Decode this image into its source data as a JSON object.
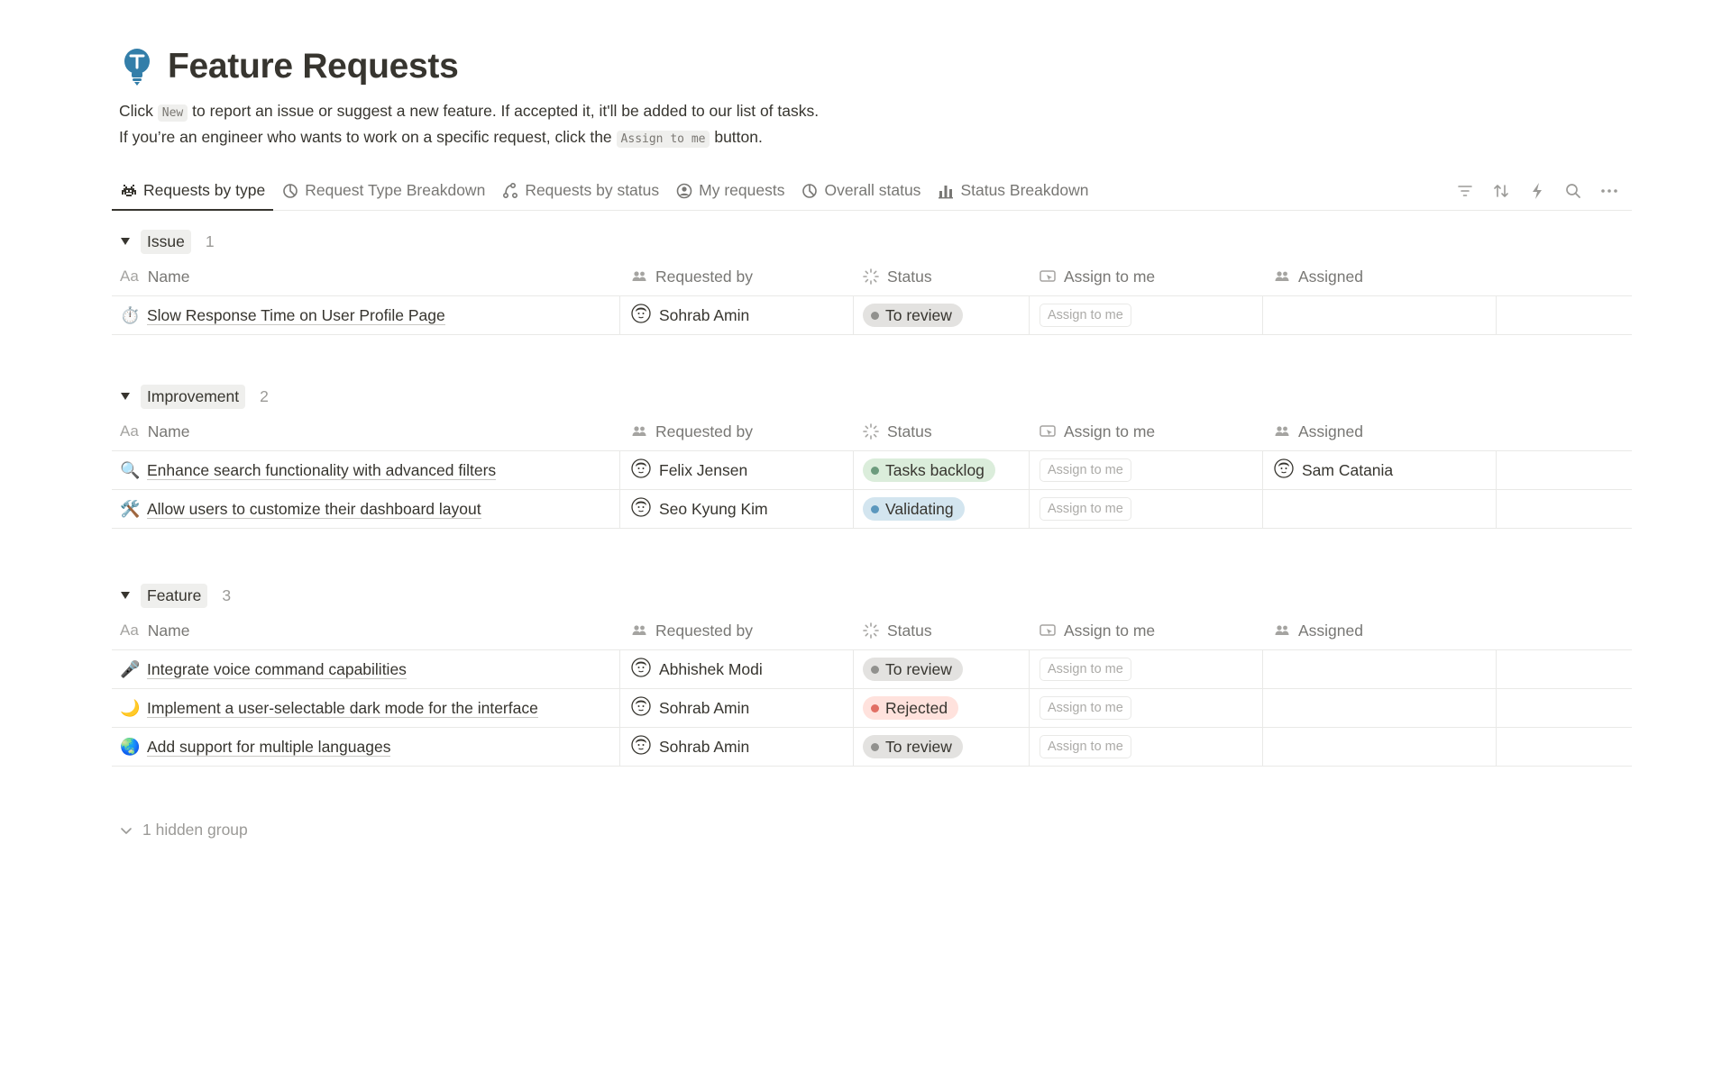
{
  "page": {
    "title": "Feature Requests",
    "icon": "lightbulb-icon",
    "desc_line1": {
      "before": "Click ",
      "code": "New",
      "after": " to report an issue or suggest a new feature. If accepted it, it'll be added to our list of tasks."
    },
    "desc_line2": {
      "before": "If you’re an engineer who wants to work on a specific request, click the ",
      "code": "Assign to me",
      "after": " button."
    }
  },
  "tabs": [
    {
      "label": "Requests by type",
      "icon": "space-invader-icon",
      "active": true
    },
    {
      "label": "Request Type Breakdown",
      "icon": "pie-chart-icon"
    },
    {
      "label": "Requests by status",
      "icon": "workflow-icon"
    },
    {
      "label": "My requests",
      "icon": "user-circle-icon"
    },
    {
      "label": "Overall status",
      "icon": "pie-chart-icon"
    },
    {
      "label": "Status Breakdown",
      "icon": "bar-chart-icon"
    }
  ],
  "toolbar": [
    "filter-icon",
    "sort-icon",
    "lightning-icon",
    "search-icon",
    "more-icon"
  ],
  "columns": {
    "name": "Name",
    "requested_by": "Requested by",
    "status": "Status",
    "assign": "Assign to me",
    "assigned": "Assigned",
    "name_prefix": "Aa"
  },
  "status_colors": {
    "To review": {
      "bg": "#e3e2e0",
      "dot": "#91918e"
    },
    "Tasks backlog": {
      "bg": "#dbeddb",
      "dot": "#6c9b7d"
    },
    "Validating": {
      "bg": "#d3e5ef",
      "dot": "#5b97bd"
    },
    "Rejected": {
      "bg": "#ffe2dd",
      "dot": "#e16f64"
    }
  },
  "assign_button_label": "Assign to me",
  "groups": [
    {
      "label": "Issue",
      "count": "1",
      "rows": [
        {
          "emoji": "⏱️",
          "name": "Slow Response Time on User Profile Page",
          "requested_by": "Sohrab Amin",
          "status": "To review",
          "assigned": ""
        }
      ]
    },
    {
      "label": "Improvement",
      "count": "2",
      "rows": [
        {
          "emoji": "🔍",
          "name": "Enhance search functionality with advanced filters",
          "requested_by": "Felix Jensen",
          "status": "Tasks backlog",
          "assigned": "Sam Catania"
        },
        {
          "emoji": "🛠️",
          "name": "Allow users to customize their dashboard layout",
          "requested_by": "Seo Kyung Kim",
          "status": "Validating",
          "assigned": ""
        }
      ]
    },
    {
      "label": "Feature",
      "count": "3",
      "rows": [
        {
          "emoji": "🎤",
          "name": "Integrate voice command capabilities",
          "requested_by": "Abhishek Modi",
          "status": "To review",
          "assigned": ""
        },
        {
          "emoji": "🌙",
          "name": "Implement a user-selectable dark mode for the interface",
          "requested_by": "Sohrab Amin",
          "status": "Rejected",
          "assigned": ""
        },
        {
          "emoji": "🌏",
          "name": "Add support for multiple languages",
          "requested_by": "Sohrab Amin",
          "status": "To review",
          "assigned": ""
        }
      ]
    }
  ],
  "hidden_group_label": "1 hidden group"
}
